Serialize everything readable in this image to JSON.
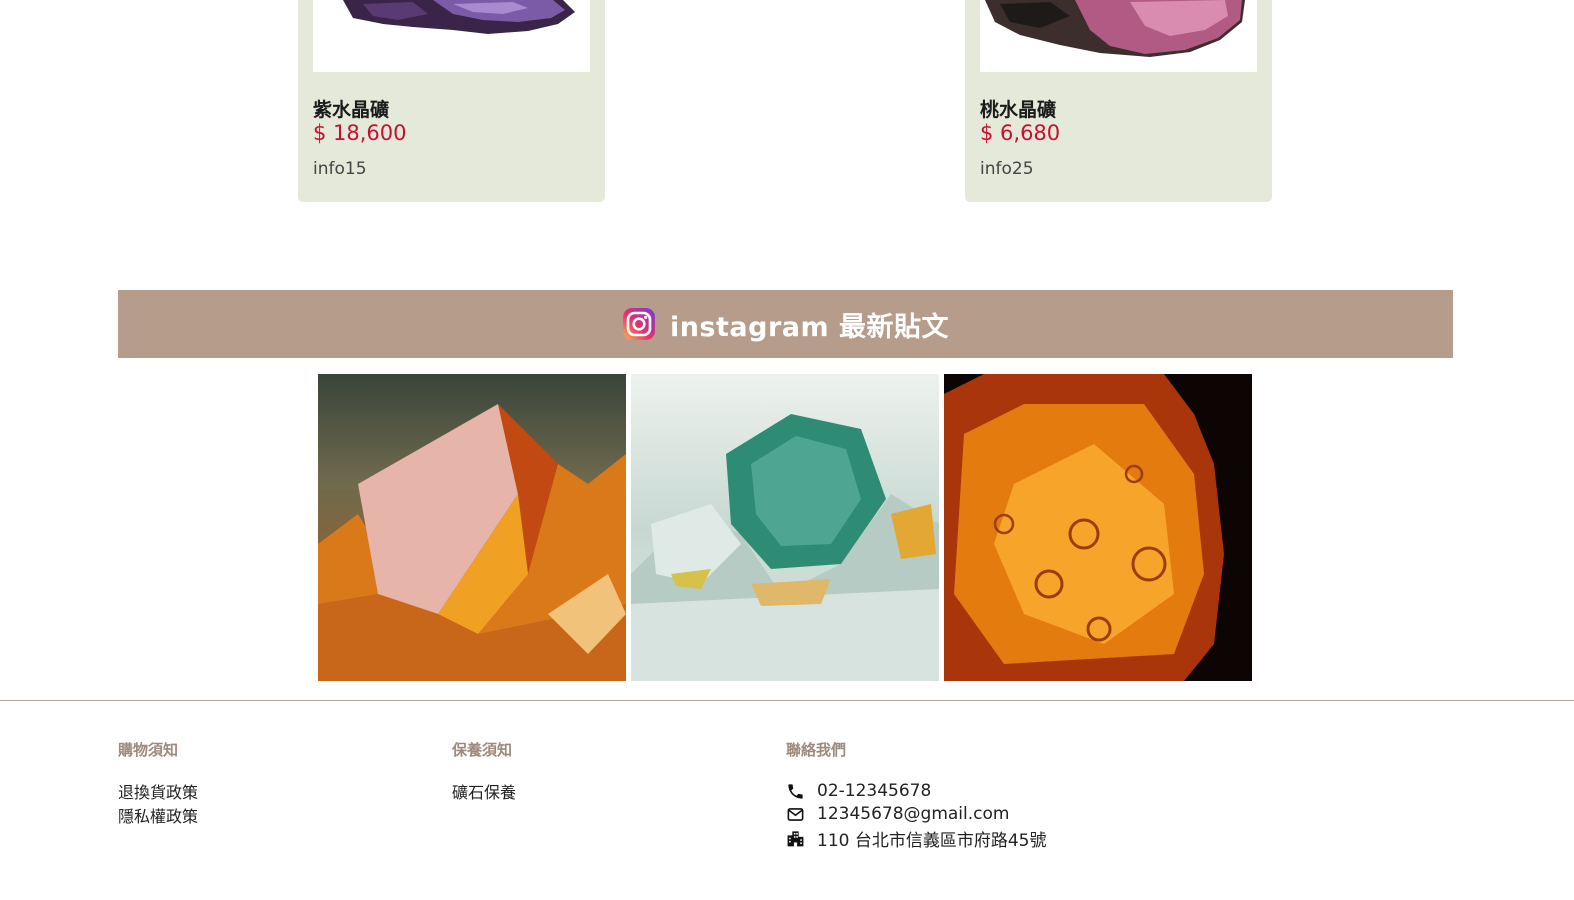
{
  "products": [
    {
      "name": "紫水晶礦",
      "price": "$ 18,600",
      "info": "info15"
    },
    {
      "name": "桃水晶礦",
      "price": "$ 6,680",
      "info": "info25"
    }
  ],
  "instagram": {
    "title": "instagram 最新貼文",
    "photos": [
      "citrine-crystal-photo",
      "green-crystal-photo",
      "amber-photo"
    ]
  },
  "footer": {
    "shopping": {
      "heading": "購物須知",
      "links": [
        "退換貨政策",
        "隱私權政策"
      ]
    },
    "care": {
      "heading": "保養須知",
      "links": [
        "礦石保養"
      ]
    },
    "contact": {
      "heading": "聯絡我們",
      "phone": "02-12345678",
      "email": "12345678@gmail.com",
      "address": "110 台北市信義區市府路45號"
    }
  },
  "colors": {
    "card_bg": "#e4e9da",
    "price": "#c8102e",
    "banner": "#b69c8b",
    "footer_heading": "#9c8a7e"
  }
}
